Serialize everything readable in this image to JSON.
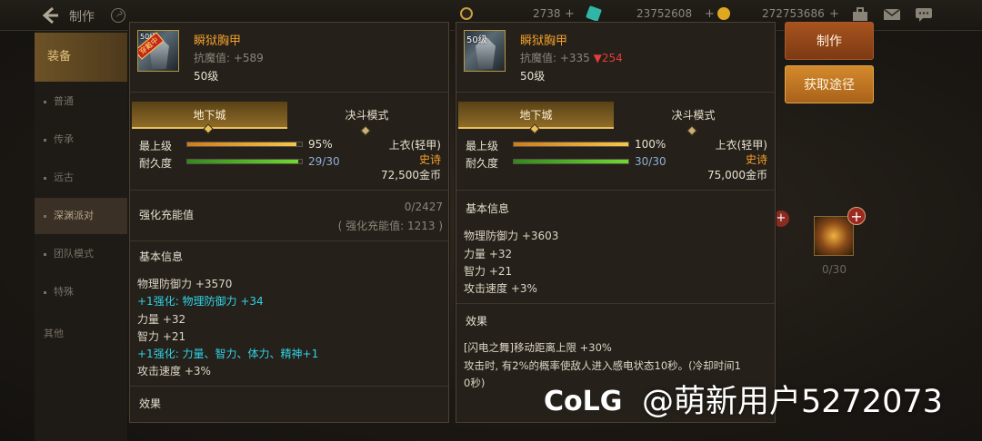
{
  "topbar": {
    "title": "制作",
    "currency": [
      {
        "value": "2738",
        "icon": "moon-icon",
        "color": "#c8a040"
      },
      {
        "value": "2375260‌8",
        "icon": "crystal-icon",
        "color": "#2fb6a6"
      },
      {
        "value": "272753686",
        "icon": "gold-coin-icon",
        "color": "#e0a820"
      }
    ]
  },
  "sidebar": {
    "items": [
      {
        "label": "装备"
      },
      {
        "label": "普通"
      },
      {
        "label": "传承"
      },
      {
        "label": "远古"
      },
      {
        "label": "深渊派对"
      },
      {
        "label": "团队模式"
      },
      {
        "label": "特殊"
      },
      {
        "label": "其他"
      }
    ]
  },
  "buttons": {
    "make": "制作",
    "obtain": "获取途径"
  },
  "slot": {
    "count": "0/30"
  },
  "left_panel": {
    "level_tag": "50级",
    "equipped_tag": "穿戴中",
    "name": "瞬狱胸甲",
    "resist": "抗魔值: +589",
    "level": "50级",
    "tabs": [
      "地下城",
      "决斗模式"
    ],
    "max_level_label": "最上级",
    "max_level_value": "95%",
    "max_level_pct": 95,
    "durability_label": "耐久度",
    "durability_value": "29/30",
    "durability_pct": 96.7,
    "slot_type": "上衣(轻甲)",
    "rarity": "史诗",
    "price": "72,500金币",
    "charge_title": "强化充能值",
    "charge_value": "0/2427",
    "charge_sub": "( 强化充能值: 1213 )",
    "basic_title": "基本信息",
    "basic_lines": [
      {
        "text": "物理防御力 +3570",
        "style": "normal"
      },
      {
        "text": "+1强化: 物理防御力 +34",
        "style": "cyan"
      },
      {
        "text": "力量 +32",
        "style": "normal"
      },
      {
        "text": "智力 +21",
        "style": "normal"
      },
      {
        "text": "+1强化: 力量、智力、体力、精神+1",
        "style": "cyan"
      },
      {
        "text": "攻击速度 +3%",
        "style": "normal"
      }
    ],
    "effect_title": "效果"
  },
  "right_panel": {
    "level_tag": "50级",
    "name": "瞬狱胸甲",
    "resist": "抗魔值: +335",
    "resist_diff": "▼254",
    "level": "50级",
    "tabs": [
      "地下城",
      "决斗模式"
    ],
    "max_level_label": "最上级",
    "max_level_value": "100%",
    "max_level_pct": 100,
    "durability_label": "耐久度",
    "durability_value": "30/30",
    "durability_pct": 100,
    "slot_type": "上衣(轻甲)",
    "rarity": "史诗",
    "price": "75,000金币",
    "basic_title": "基本信息",
    "basic_lines": [
      {
        "text": "物理防御力 +3603"
      },
      {
        "text": "力量 +32"
      },
      {
        "text": "智力 +21"
      },
      {
        "text": "攻击速度 +3%"
      }
    ],
    "effect_title": "效果",
    "effect_lines": [
      {
        "text": "[闪电之舞]移动距离上限 +30%"
      },
      {
        "text": "攻击时, 有2%的概率使敌人进入感电状态10秒。(冷却时间1"
      },
      {
        "text": "0秒)"
      }
    ]
  },
  "watermark": {
    "text": "@萌新用户5272073",
    "logo": "colg-logo"
  }
}
